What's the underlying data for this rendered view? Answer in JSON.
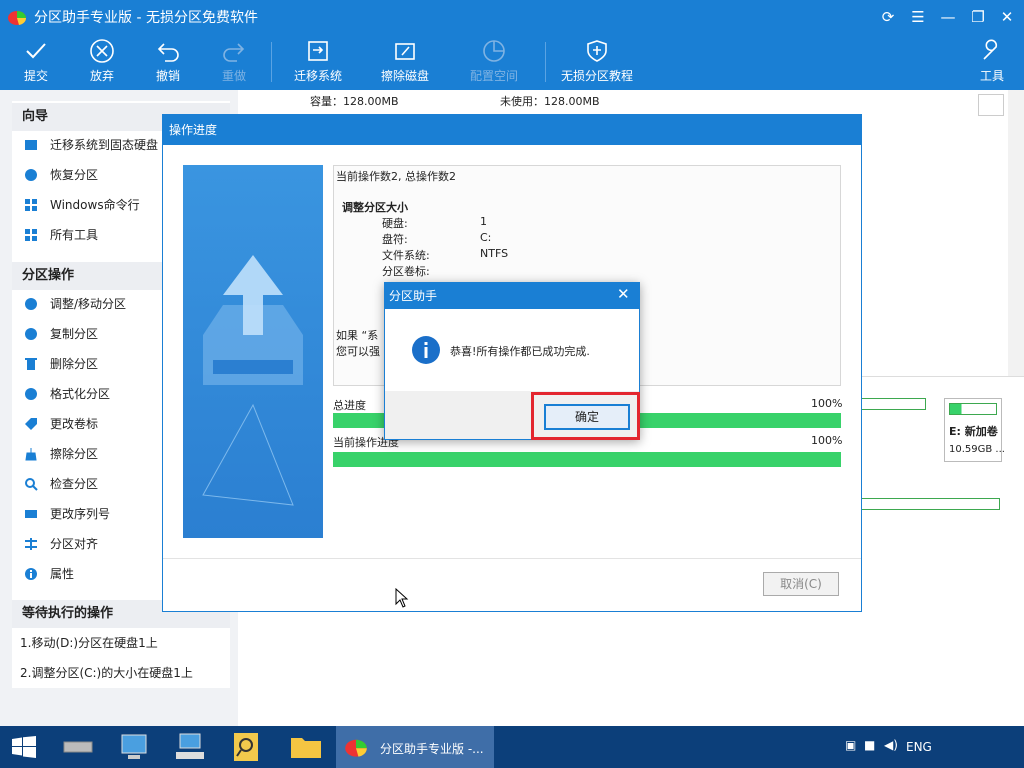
{
  "window": {
    "title": "分区助手专业版 - 无损分区免费软件"
  },
  "toolbar": {
    "items": [
      {
        "label": "提交",
        "icon": "check-icon"
      },
      {
        "label": "放弃",
        "icon": "cancel-circle-icon"
      },
      {
        "label": "撤销",
        "icon": "undo-icon"
      },
      {
        "label": "重做",
        "icon": "redo-icon"
      },
      {
        "label": "迁移系统",
        "icon": "migrate-icon"
      },
      {
        "label": "擦除磁盘",
        "icon": "wipe-disk-icon"
      },
      {
        "label": "配置空间",
        "icon": "allocate-space-icon"
      },
      {
        "label": "无损分区教程",
        "icon": "shield-icon"
      },
      {
        "label": "工具",
        "icon": "wrench-icon"
      }
    ]
  },
  "sidebar": {
    "wizard_title": "向导",
    "wizard_items": [
      "迁移系统到固态硬盘",
      "恢复分区",
      "Windows命令行",
      "所有工具"
    ],
    "ops_title": "分区操作",
    "ops_items": [
      "调整/移动分区",
      "复制分区",
      "删除分区",
      "格式化分区",
      "更改卷标",
      "擦除分区",
      "检查分区",
      "更改序列号",
      "分区对齐",
      "属性"
    ],
    "pending_title": "等待执行的操作",
    "pending_items": [
      "1.移动(D:)分区在硬盘1上",
      "2.调整分区(C:)的大小在硬盘1上"
    ]
  },
  "main": {
    "capacity": "容量：128.00MB",
    "unused": "未使用：128.00MB",
    "drive_e_name": "E: 新加卷",
    "drive_e_size": "10.59GB ..."
  },
  "progress_dialog": {
    "title": "操作进度",
    "log_line1": "当前操作数2,  总操作数2",
    "log_heading": "调整分区大小",
    "fields": [
      {
        "label": "硬盘:",
        "value": "1"
      },
      {
        "label": "盘符:",
        "value": "C:"
      },
      {
        "label": "文件系统:",
        "value": "NTFS"
      },
      {
        "label": "分区卷标:",
        "value": ""
      }
    ],
    "log_tail1": "如果 “系",
    "log_tail2": "您可以强",
    "total_label": "总进度",
    "total_pct": "100%",
    "total_value": 1.0,
    "current_label": "当前操作进度",
    "current_pct": "100%",
    "current_value": 1.0,
    "cancel_label": "取消(C)"
  },
  "msgbox": {
    "title": "分区助手",
    "message": "恭喜!所有操作都已成功完成.",
    "ok_label": "确定"
  },
  "taskbar": {
    "app_label": "分区助手专业版 -...",
    "lang": "ENG"
  }
}
